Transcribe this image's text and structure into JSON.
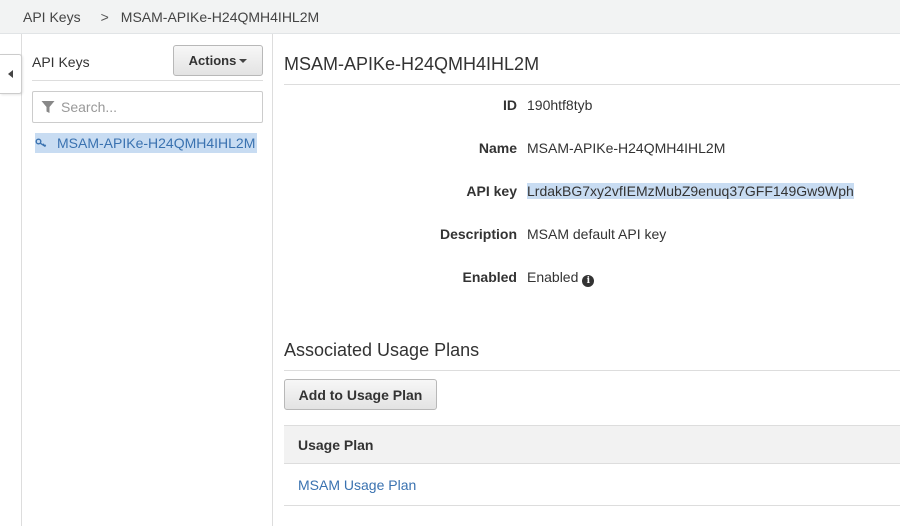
{
  "breadcrumb": {
    "root": "API Keys",
    "separator": ">",
    "current": "MSAM-APIKe-H24QMH4IHL2M"
  },
  "sidebar": {
    "title": "API Keys",
    "actions_label": "Actions",
    "search_placeholder": "Search...",
    "items": [
      {
        "label": "MSAM-APIKe-H24QMH4IHL2M",
        "icon": "key-icon",
        "selected": true
      }
    ]
  },
  "detail": {
    "title": "MSAM-APIKe-H24QMH4IHL2M",
    "fields": {
      "id": {
        "label": "ID",
        "value": "190htf8tyb"
      },
      "name": {
        "label": "Name",
        "value": "MSAM-APIKe-H24QMH4IHL2M"
      },
      "api_key": {
        "label": "API key",
        "value": "LrdakBG7xy2vfIEMzMubZ9enuq37GFF149Gw9Wph"
      },
      "description": {
        "label": "Description",
        "value": "MSAM default API key"
      },
      "enabled": {
        "label": "Enabled",
        "value": "Enabled",
        "icon": "info-icon"
      }
    }
  },
  "usage_plans": {
    "title": "Associated Usage Plans",
    "add_label": "Add to Usage Plan",
    "column_header": "Usage Plan",
    "rows": [
      {
        "name": "MSAM Usage Plan"
      }
    ]
  },
  "colors": {
    "link": "#3a72b0",
    "selection": "#c8dcf2",
    "header_bg": "#f2f3f3"
  }
}
